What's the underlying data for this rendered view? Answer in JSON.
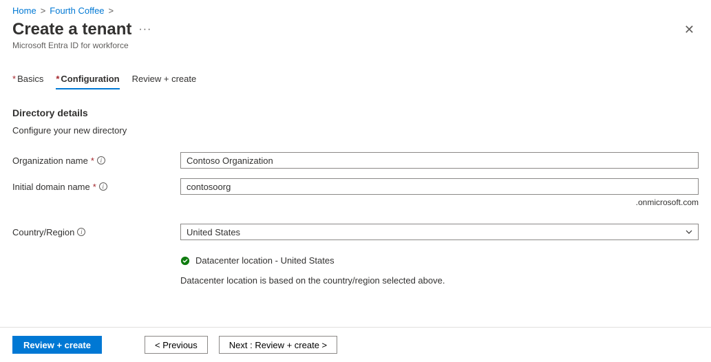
{
  "breadcrumb": {
    "home": "Home",
    "parent": "Fourth Coffee"
  },
  "header": {
    "title": "Create a tenant",
    "subtitle": "Microsoft Entra ID for workforce"
  },
  "tabs": {
    "basics": "Basics",
    "configuration": "Configuration",
    "review": "Review + create"
  },
  "section": {
    "title": "Directory details",
    "desc": "Configure your new directory"
  },
  "form": {
    "org_label": "Organization name",
    "org_value": "Contoso Organization",
    "domain_label": "Initial domain name",
    "domain_value": "contosoorg",
    "domain_suffix": ".onmicrosoft.com",
    "region_label": "Country/Region",
    "region_value": "United States",
    "dc_location": "Datacenter location - United States",
    "dc_note": "Datacenter location is based on the country/region selected above."
  },
  "footer": {
    "review": "Review + create",
    "previous": "< Previous",
    "next": "Next : Review + create >"
  }
}
